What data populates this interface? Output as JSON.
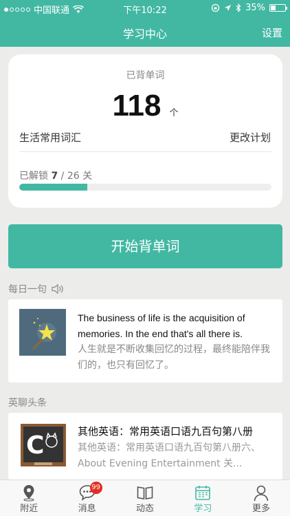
{
  "status_bar": {
    "carrier": "中国联通",
    "time": "下午10:22",
    "battery": "35%",
    "battery_level": 0.35
  },
  "nav": {
    "title": "学习中心",
    "settings": "设置"
  },
  "progress_card": {
    "label": "已背单词",
    "count": "118",
    "unit": "个",
    "plan_name": "生活常用词汇",
    "change_plan": "更改计划",
    "unlock_prefix": "已解锁",
    "unlocked": "7",
    "total": "/ 26",
    "unlock_suffix": "关",
    "progress": 0.269
  },
  "start_button": "开始背单词",
  "daily": {
    "label": "每日一句",
    "english": "The business of life is the acquisition of memories. In the end that's all there is.",
    "chinese": "人生就是不断收集回忆的过程，最终能陪伴我们的，也只有回忆了。"
  },
  "news": {
    "label": "英聊头条",
    "title": "其他英语：常用英语口语九百句第八册",
    "description": "其他英语：常用英语口语九百句第八册六、 About Evening Entertainment 关..."
  },
  "tabs": [
    {
      "label": "附近",
      "icon": "location-pin-icon"
    },
    {
      "label": "消息",
      "icon": "chat-bubble-icon",
      "badge": "99"
    },
    {
      "label": "动态",
      "icon": "open-book-icon"
    },
    {
      "label": "学习",
      "icon": "calendar-icon",
      "active": true
    },
    {
      "label": "更多",
      "icon": "person-icon"
    }
  ],
  "colors": {
    "accent": "#42b8a3",
    "badge": "#e32d22",
    "background": "#ececea"
  }
}
